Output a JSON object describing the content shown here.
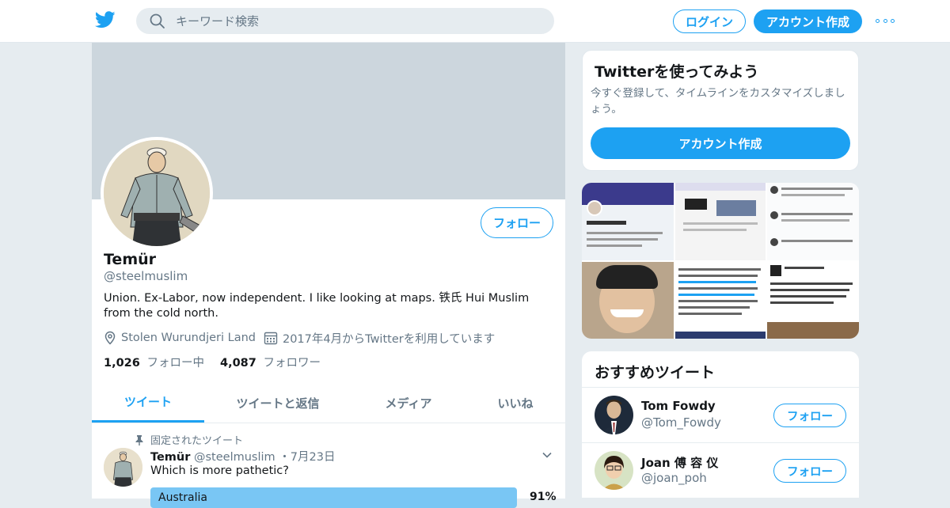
{
  "header": {
    "search_placeholder": "キーワード検索",
    "login_label": "ログイン",
    "signup_label": "アカウント作成"
  },
  "profile": {
    "name": "Temür",
    "handle": "@steelmuslim",
    "bio": "Union. Ex-Labor, now independent. I like looking at maps. 铁氏 Hui Muslim from the cold north.",
    "location": "Stolen Wurundjeri Land",
    "joined": "2017年4月からTwitterを利用しています",
    "following_count": "1,026",
    "following_label": "フォロー中",
    "followers_count": "4,087",
    "followers_label": "フォロワー",
    "follow_label": "フォロー"
  },
  "tabs": [
    {
      "label": "ツイート",
      "active": true
    },
    {
      "label": "ツイートと返信",
      "active": false
    },
    {
      "label": "メディア",
      "active": false
    },
    {
      "label": "いいね",
      "active": false
    }
  ],
  "pinned_tweet": {
    "pinned_label": "固定されたツイート",
    "author": "Temür",
    "handle": "@steelmuslim",
    "date": "・7月23日",
    "text": "Which is more pathetic?",
    "poll_option": "Australia",
    "poll_percent": "91%"
  },
  "signup_card": {
    "title": "Twitterを使ってみよう",
    "description": "今すぐ登録して、タイムラインをカスタマイズしましょう。",
    "button": "アカウント作成"
  },
  "recommended": {
    "title": "おすすめツイート",
    "users": [
      {
        "name": "Tom Fowdy",
        "handle": "@Tom_Fowdy",
        "follow": "フォロー"
      },
      {
        "name": "Joan 傅 容 仪",
        "handle": "@joan_poh",
        "follow": "フォロー"
      }
    ]
  },
  "colors": {
    "accent": "#1da1f2",
    "background": "#e6ecf0",
    "banner": "#ccd6dd",
    "muted_text": "#657786"
  },
  "icons": [
    "twitter-bird-icon",
    "search-icon",
    "more-icon",
    "location-icon",
    "calendar-icon",
    "pin-icon",
    "chevron-down-icon"
  ]
}
